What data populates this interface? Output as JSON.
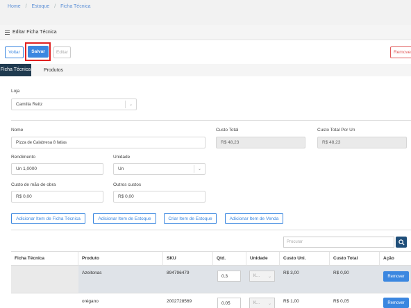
{
  "breadcrumb": [
    "Home",
    "Estoque",
    "Ficha Técnica"
  ],
  "breadcrumb_separator": "/",
  "panel": {
    "title": "Editar Ficha Técnica"
  },
  "toolbar": {
    "voltar": "Voltar",
    "salvar": "Salvar",
    "editar": "Editar",
    "remover": "Remover"
  },
  "tabs": [
    {
      "label": "Ficha Técnica",
      "active": true
    },
    {
      "label": "Produtos",
      "active": false
    }
  ],
  "form": {
    "loja_label": "Loja",
    "loja_value": "Camilla Reitz",
    "nome_label": "Nome",
    "nome_value": "Pizza de Calabresa 8 fatias",
    "custo_total_label": "Custo Total",
    "custo_total_value": "R$ 48,23",
    "custo_total_un_label": "Custo Total Por Un",
    "custo_total_un_value": "R$ 48,23",
    "rendimento_label": "Rendimento",
    "rendimento_value": "Un 1,0000",
    "unidade_label": "Unidade",
    "unidade_value": "Un",
    "mao_obra_label": "Custo de mão de obra",
    "mao_obra_value": "R$ 0,00",
    "outros_label": "Outros custos",
    "outros_value": "R$ 0,00"
  },
  "actions": {
    "add_ficha": "Adicionar Item de Ficha Técnica",
    "add_estoque": "Adicionar Item de Estoque",
    "criar_estoque": "Criar Item de Estoque",
    "add_venda": "Adicionar Item de Venda"
  },
  "search": {
    "placeholder": "Procurar"
  },
  "table": {
    "headers": [
      "Ficha Técnica",
      "Produto",
      "SKU",
      "Qtd.",
      "Unidade",
      "Custo Uni.",
      "Custo Total",
      "Ação"
    ],
    "rows": [
      {
        "ficha": "",
        "produto": "Azeitonas",
        "sku": "894796479",
        "qtd": "0.3",
        "unidade": "K...",
        "custo_uni": "R$ 3,00",
        "custo_total": "R$ 0,90",
        "acao": "Remover"
      },
      {
        "ficha": "",
        "produto": "orégano",
        "sku": "2002728569",
        "qtd": "0.05",
        "unidade": "K...",
        "custo_uni": "R$ 1,00",
        "custo_total": "R$ 0,05",
        "acao": "Remover"
      }
    ]
  },
  "colors": {
    "primary": "#3b87e0",
    "dark_tab": "#1f3a4f",
    "danger": "#e05a5a",
    "highlight": "#e02020"
  }
}
